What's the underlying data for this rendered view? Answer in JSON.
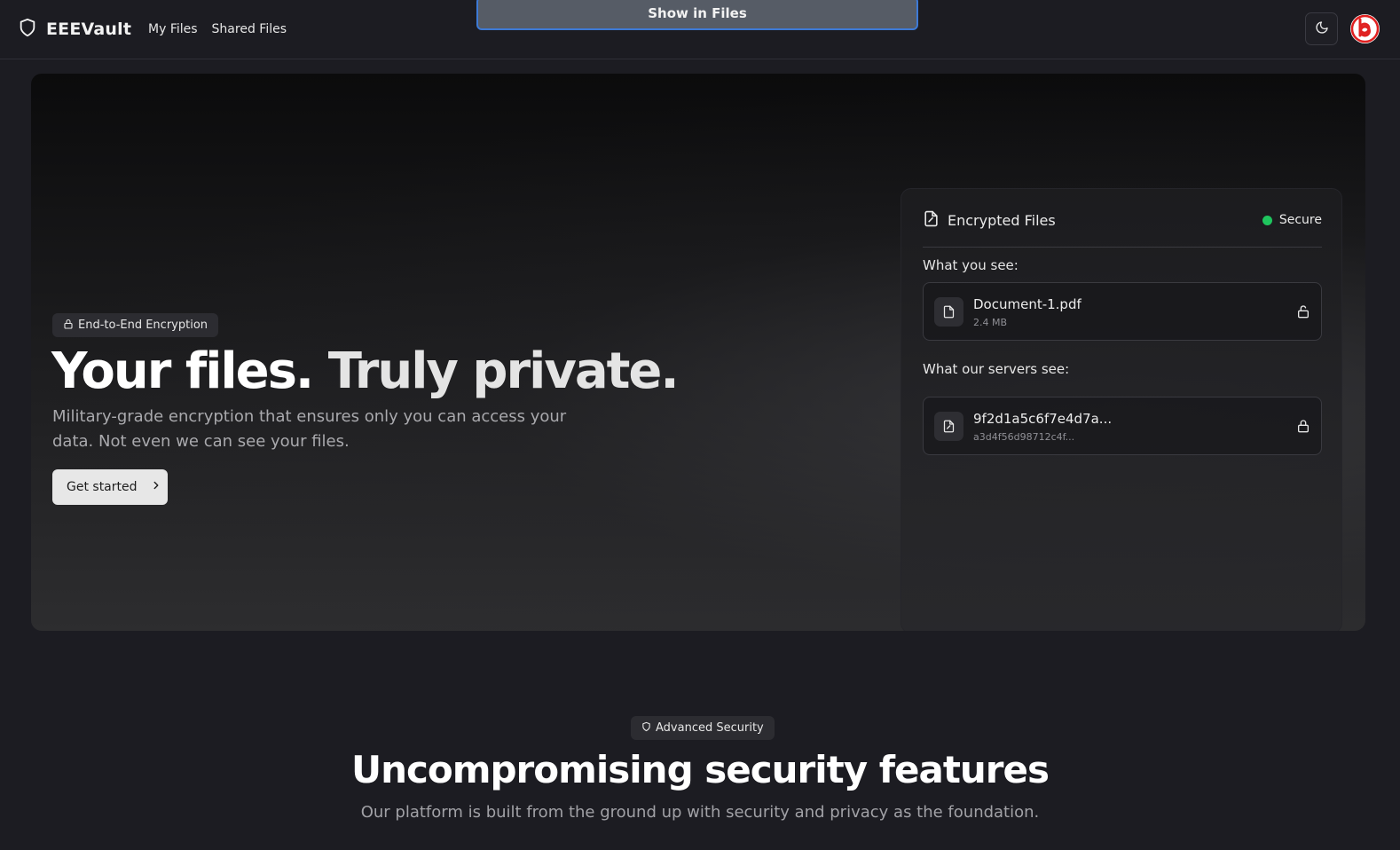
{
  "header": {
    "brand": "EEEVault",
    "nav": [
      "My Files",
      "Shared Files"
    ],
    "toast_button": "Show in Files"
  },
  "hero": {
    "badge": "End-to-End Encryption",
    "title_part1": "Your files.",
    "title_part2": "Truly private.",
    "description": "Military-grade encryption that ensures only you can access your data. Not even we can see your files.",
    "cta": "Get started"
  },
  "card": {
    "title": "Encrypted Files",
    "status": "Secure",
    "status_color": "#1fc55e",
    "you_see_label": "What you see:",
    "you_see_file": {
      "name": "Document-1.pdf",
      "size": "2.4 MB"
    },
    "servers_label": "What our servers see:",
    "server_file": {
      "name": "9f2d1a5c6f7e4d7a...",
      "hash": "a3d4f56d98712c4f..."
    }
  },
  "features": {
    "badge": "Advanced Security",
    "title": "Uncompromising security features",
    "description": "Our platform is built from the ground up with security and privacy as the foundation."
  },
  "colors": {
    "background": "#1c1c22",
    "toast_border": "#3d7ad6",
    "avatar_logo": "#e02020"
  },
  "icons": [
    "shield-icon",
    "moon-icon",
    "lock-icon",
    "file-icon",
    "file-lock-icon",
    "chevron-right-icon",
    "unlock-icon"
  ]
}
